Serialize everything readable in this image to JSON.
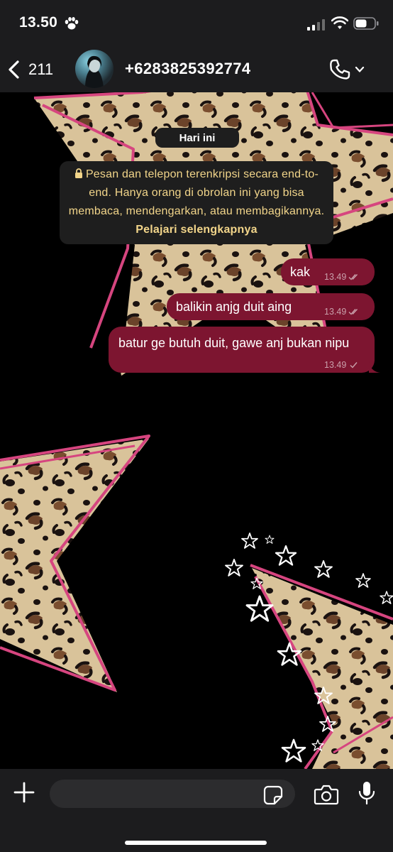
{
  "status_bar": {
    "time": "13.50",
    "icons": [
      "paw-icon",
      "signal-icon",
      "wifi-icon",
      "battery-icon"
    ]
  },
  "header": {
    "back_count": "211",
    "contact_name": "+6283825392774",
    "icons": [
      "back-icon",
      "phone-icon",
      "chevron-down-icon"
    ]
  },
  "chat": {
    "date_label": "Hari ini",
    "encryption_notice": "Pesan dan telepon terenkripsi secara end-to-end. Hanya orang di obrolan ini yang bisa membaca, mendengarkan, atau membagikannya.",
    "learn_more": "Pelajari selengkapnya",
    "messages": [
      {
        "text": "kak",
        "time": "13.49",
        "status": "read"
      },
      {
        "text": "balikin anjg duit aing",
        "time": "13.49",
        "status": "read"
      },
      {
        "text": "batur ge butuh duit, gawe anj bukan nipu",
        "time": "13.49",
        "status": "sent"
      }
    ]
  },
  "input_bar": {
    "placeholder": "",
    "icons": [
      "plus-icon",
      "sticker-icon",
      "camera-icon",
      "mic-icon"
    ]
  },
  "colors": {
    "bubble": "#7d1530",
    "notice_text": "#f2d58a",
    "bars": "#1c1c1e",
    "wallpaper_accent": "#d6457f"
  }
}
